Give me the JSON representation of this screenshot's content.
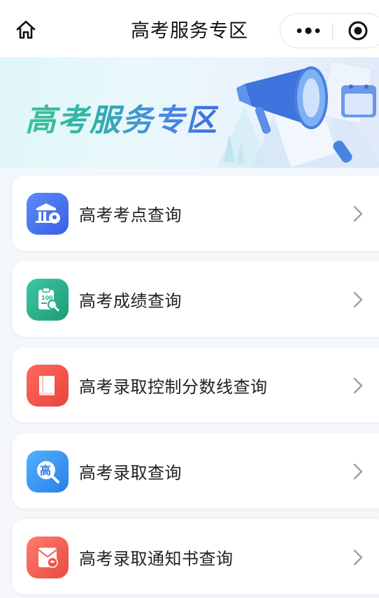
{
  "navbar": {
    "title": "高考服务专区",
    "home_icon": "home-icon",
    "more_icon": "more-dots-icon",
    "target_icon": "close-target-icon"
  },
  "banner": {
    "title": "高考服务专区"
  },
  "services": [
    {
      "label": "高考考点查询",
      "icon": "exam-venue-icon",
      "color": "#3f6cf0"
    },
    {
      "label": "高考成绩查询",
      "icon": "score-search-icon",
      "color": "#27b08a"
    },
    {
      "label": "高考录取控制分数线查询",
      "icon": "book-icon",
      "color": "#f2534b"
    },
    {
      "label": "高考录取查询",
      "icon": "admission-search-icon",
      "color": "#3593f2"
    },
    {
      "label": "高考录取通知书查询",
      "icon": "notice-letter-icon",
      "color": "#f2534b"
    }
  ]
}
